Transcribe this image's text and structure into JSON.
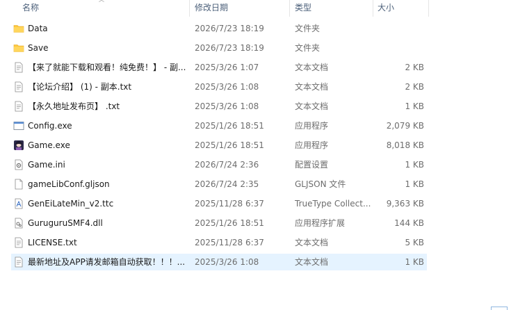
{
  "columns": {
    "name": "名称",
    "date": "修改日期",
    "type": "类型",
    "size": "大小"
  },
  "files": [
    {
      "name": "Data",
      "date": "2026/7/23 18:19",
      "type": "文件夹",
      "size": "",
      "icon": "folder-icon"
    },
    {
      "name": "Save",
      "date": "2026/7/23 18:19",
      "type": "文件夹",
      "size": "",
      "icon": "folder-icon"
    },
    {
      "name": "【来了就能下载和观看！纯免费！】 - 副...",
      "date": "2025/3/26 1:07",
      "type": "文本文档",
      "size": "2 KB",
      "icon": "text-file-icon"
    },
    {
      "name": "【论坛介绍】 (1) - 副本.txt",
      "date": "2025/3/26 1:08",
      "type": "文本文档",
      "size": "2 KB",
      "icon": "text-file-icon"
    },
    {
      "name": "【永久地址发布页】 .txt",
      "date": "2025/3/26 1:08",
      "type": "文本文档",
      "size": "1 KB",
      "icon": "text-file-icon"
    },
    {
      "name": "Config.exe",
      "date": "2025/1/26 18:51",
      "type": "应用程序",
      "size": "2,079 KB",
      "icon": "app-window-icon"
    },
    {
      "name": "Game.exe",
      "date": "2025/1/26 18:51",
      "type": "应用程序",
      "size": "8,018 KB",
      "icon": "game-app-icon"
    },
    {
      "name": "Game.ini",
      "date": "2026/7/24 2:36",
      "type": "配置设置",
      "size": "1 KB",
      "icon": "config-file-icon"
    },
    {
      "name": "gameLibConf.gljson",
      "date": "2026/7/24 2:35",
      "type": "GLJSON 文件",
      "size": "1 KB",
      "icon": "blank-file-icon"
    },
    {
      "name": "GenEiLateMin_v2.ttc",
      "date": "2025/11/28 6:37",
      "type": "TrueType Collect...",
      "size": "9,363 KB",
      "icon": "font-file-icon"
    },
    {
      "name": "GuruguruSMF4.dll",
      "date": "2025/1/26 18:51",
      "type": "应用程序扩展",
      "size": "144 KB",
      "icon": "dll-file-icon"
    },
    {
      "name": "LICENSE.txt",
      "date": "2025/11/28 6:37",
      "type": "文本文档",
      "size": "5 KB",
      "icon": "text-file-icon"
    },
    {
      "name": "最新地址及APP请发邮箱自动获取！！！...",
      "date": "2025/3/26 1:08",
      "type": "文本文档",
      "size": "1 KB",
      "icon": "text-file-icon"
    }
  ],
  "selected_index": 12,
  "colors": {
    "header_text": "#4c607a",
    "selection": "#e5f3ff",
    "folder": "#ffc83d"
  }
}
